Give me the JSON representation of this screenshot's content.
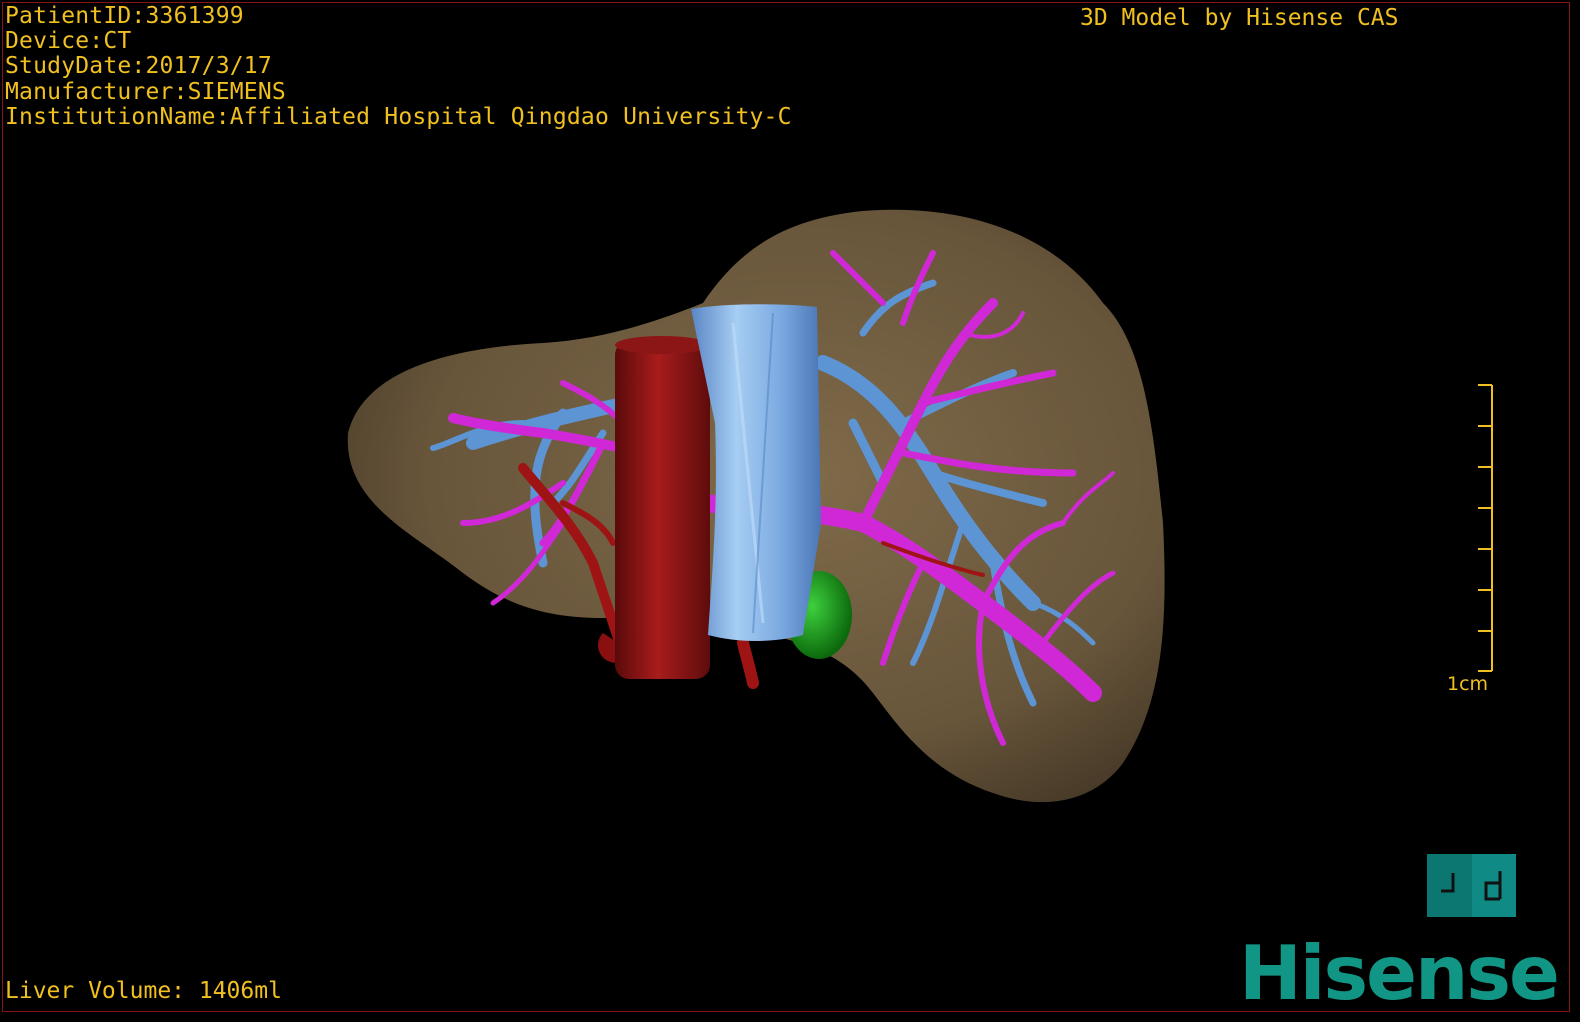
{
  "overlay": {
    "patient_id": "PatientID:3361399",
    "device": "Device:CT",
    "study_date": "StudyDate:2017/3/17",
    "manufacturer": "Manufacturer:SIEMENS",
    "institution": "InstitutionName:Affiliated Hospital Qingdao University-C"
  },
  "credit": "3D Model by Hisense CAS",
  "volume": "Liver Volume: 1406ml",
  "scale_bar": {
    "label": "1cm"
  },
  "view_button": {
    "icon": "pd-toggle-icon"
  },
  "brand": {
    "logo_text": "Hisense"
  },
  "colors": {
    "overlay_text": "#f0c020",
    "liver": "#6e5a3e",
    "portal_vein": "#d028d6",
    "hepatic_vein": "#5c94d4",
    "artery": "#9e1414",
    "ivc": "#8a1414",
    "tube": "#88b6e6",
    "gallbladder": "#18a018",
    "brand": "#119685"
  }
}
